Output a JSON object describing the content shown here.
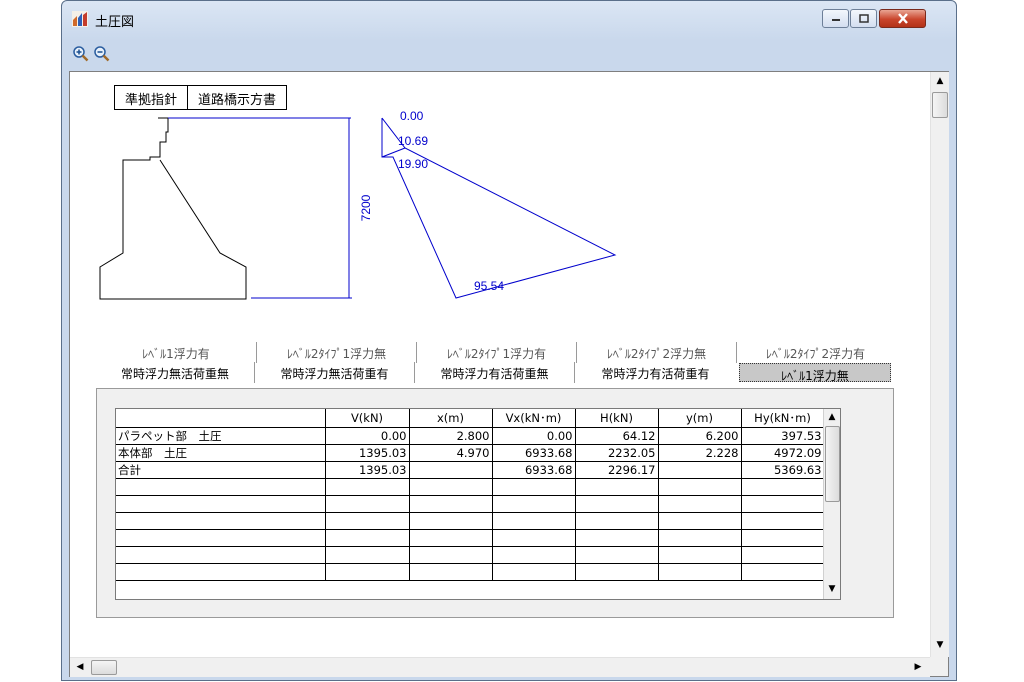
{
  "window": {
    "title": "土圧図",
    "icons": {
      "app": "chart-app-icon",
      "minimize": "minimize-icon",
      "maximize": "maximize-icon",
      "close": "close-icon"
    },
    "accent": "#c9452c"
  },
  "toolbar": {
    "zoom_in": "zoom-in-icon",
    "zoom_out": "zoom-out-icon"
  },
  "standard": {
    "label": "準拠指針",
    "value": "道路橋示方書"
  },
  "drawing": {
    "height_dim": "7200",
    "pressure_labels": [
      "0.00",
      "10.69",
      "19.90",
      "95.54"
    ],
    "line_color": "#0000cc"
  },
  "tabs": {
    "back_row": [
      "ﾚﾍﾞﾙ1浮力有",
      "ﾚﾍﾞﾙ2ﾀｲﾌﾟ1浮力無",
      "ﾚﾍﾞﾙ2ﾀｲﾌﾟ1浮力有",
      "ﾚﾍﾞﾙ2ﾀｲﾌﾟ2浮力無",
      "ﾚﾍﾞﾙ2ﾀｲﾌﾟ2浮力有"
    ],
    "front_row": [
      "常時浮力無活荷重無",
      "常時浮力無活荷重有",
      "常時浮力有活荷重無",
      "常時浮力有活荷重有",
      "ﾚﾍﾞﾙ1浮力無"
    ],
    "selected": "ﾚﾍﾞﾙ1浮力無"
  },
  "table": {
    "headers": [
      "",
      "V(kN)",
      "x(m)",
      "Vx(kN･m)",
      "H(kN)",
      "y(m)",
      "Hy(kN･m)"
    ],
    "rows": [
      [
        "パラペット部　土圧",
        "0.00",
        "2.800",
        "0.00",
        "64.12",
        "6.200",
        "397.53"
      ],
      [
        "本体部　土圧",
        "1395.03",
        "4.970",
        "6933.68",
        "2232.05",
        "2.228",
        "4972.09"
      ],
      [
        "合計",
        "1395.03",
        "",
        "6933.68",
        "2296.17",
        "",
        "5369.63"
      ],
      [
        "",
        "",
        "",
        "",
        "",
        "",
        ""
      ],
      [
        "",
        "",
        "",
        "",
        "",
        "",
        ""
      ],
      [
        "",
        "",
        "",
        "",
        "",
        "",
        ""
      ],
      [
        "",
        "",
        "",
        "",
        "",
        "",
        ""
      ],
      [
        "",
        "",
        "",
        "",
        "",
        "",
        ""
      ],
      [
        "",
        "",
        "",
        "",
        "",
        "",
        ""
      ]
    ]
  }
}
